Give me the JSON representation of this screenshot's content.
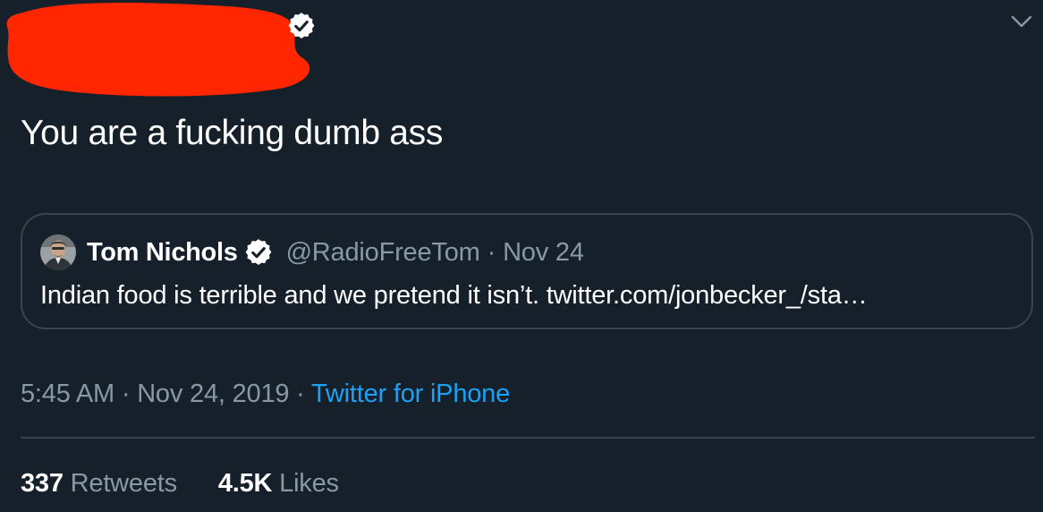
{
  "tweet": {
    "text": "You are a fucking dumb ass",
    "time": "5:45 AM",
    "separator": "·",
    "date": "Nov 24, 2019",
    "source": "Twitter for iPhone",
    "retweets_count": "337",
    "retweets_label": "Retweets",
    "likes_count": "4.5K",
    "likes_label": "Likes"
  },
  "quote": {
    "name": "Tom Nichols",
    "handle": "@RadioFreeTom",
    "separator": "·",
    "date": "Nov 24",
    "text": "Indian food is terrible and we pretend it isn’t. twitter.com/jonbecker_/sta…"
  },
  "icons": {
    "verified": "verified-badge-icon",
    "menu": "chevron-down-icon"
  },
  "colors": {
    "background": "#15202b",
    "accent": "#1da1f2",
    "muted_text": "#8899a6",
    "border": "#38444d",
    "redaction": "#ff2600"
  }
}
